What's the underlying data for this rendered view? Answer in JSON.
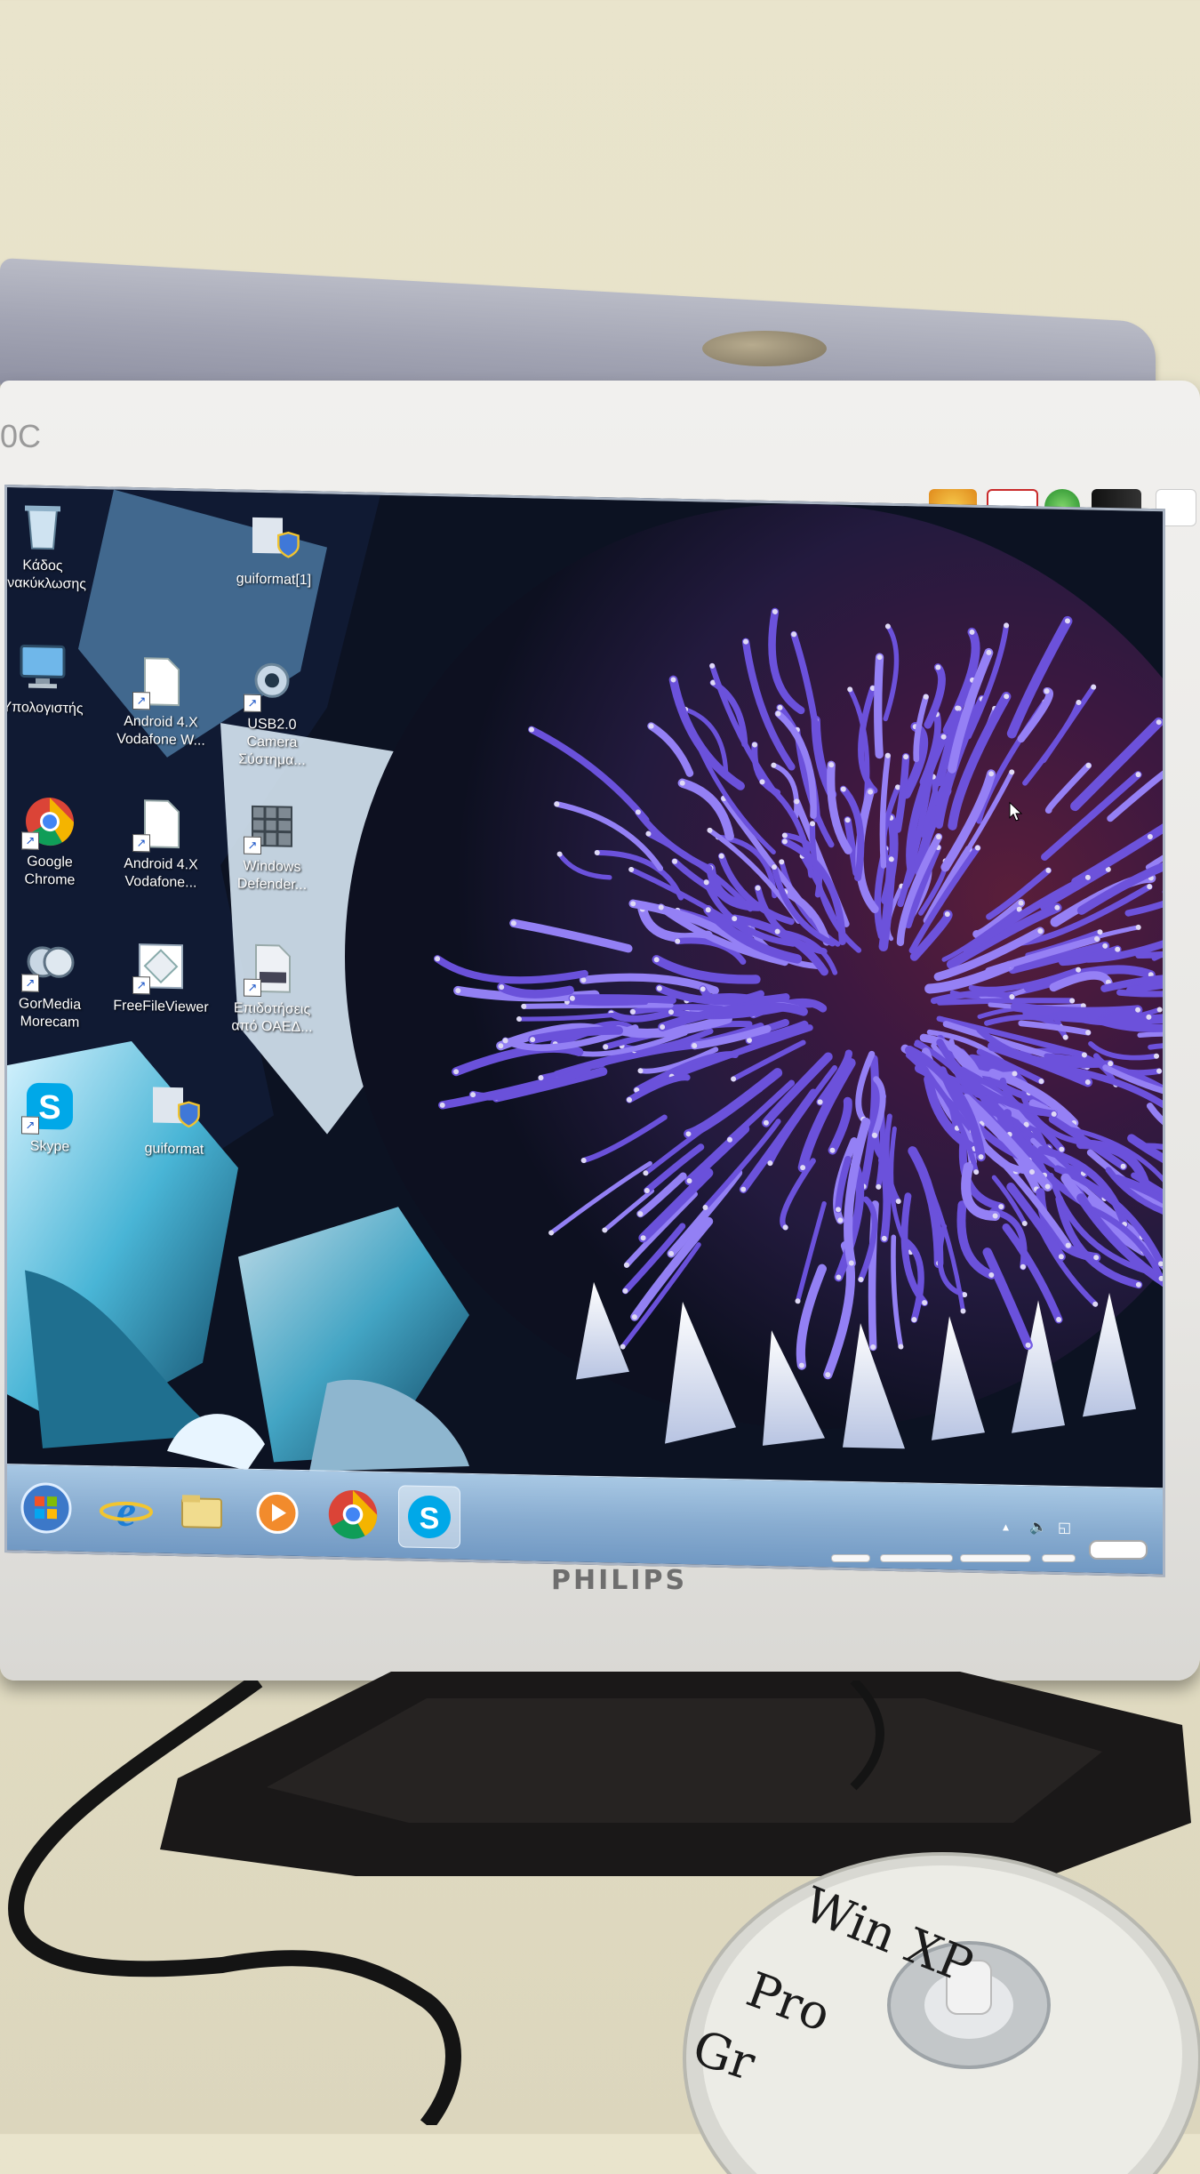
{
  "bezel": {
    "model_text": "0C",
    "brand": "PHILIPS"
  },
  "desktop": {
    "icons": [
      {
        "label": "Κάδος\nανακύκλωσης",
        "icon": "recycle-bin-icon"
      },
      {
        "label": "guiformat[1]",
        "icon": "shield-file-icon"
      },
      {
        "label": "Υπολογιστής",
        "icon": "computer-icon"
      },
      {
        "label": "Android 4.X\nVodafone W...",
        "icon": "document-icon"
      },
      {
        "label": "USB2.0 Camera\nΣύστημα...",
        "icon": "webcam-icon"
      },
      {
        "label": "Google\nChrome",
        "icon": "chrome-icon"
      },
      {
        "label": "Android 4.X\nVodafone...",
        "icon": "document-icon"
      },
      {
        "label": "Windows\nDefender...",
        "icon": "defender-icon"
      },
      {
        "label": "GorMedia\nMorecam",
        "icon": "morecam-icon"
      },
      {
        "label": "FreeFileViewer",
        "icon": "freefileviewer-icon"
      },
      {
        "label": "Επιδοτήσεις\nαπό ΟΑΕΔ...",
        "icon": "docx-icon"
      },
      {
        "label": "Skype",
        "icon": "skype-icon"
      },
      {
        "label": "guiformat",
        "icon": "shield-file-icon"
      }
    ]
  },
  "taskbar": {
    "items": [
      "start-orb-icon",
      "internet-explorer-icon",
      "file-explorer-icon",
      "media-player-icon",
      "chrome-icon",
      "skype-icon"
    ],
    "active_item": "skype-icon",
    "tray_icons": [
      "chevron-up-icon",
      "speaker-icon",
      "network-icon"
    ]
  },
  "stickers": [
    "sticker-logo-1",
    "built-in-sticker",
    "green-logo-sticker",
    "srs-sticker",
    "smart-sticker"
  ],
  "disc": {
    "handwriting": [
      "Win XP",
      "Pro",
      "Gr"
    ]
  },
  "colors": {
    "wallpaper_purple": "#6a4fd0",
    "taskbar": "#88acd0",
    "bezel": "#ecebe8"
  }
}
